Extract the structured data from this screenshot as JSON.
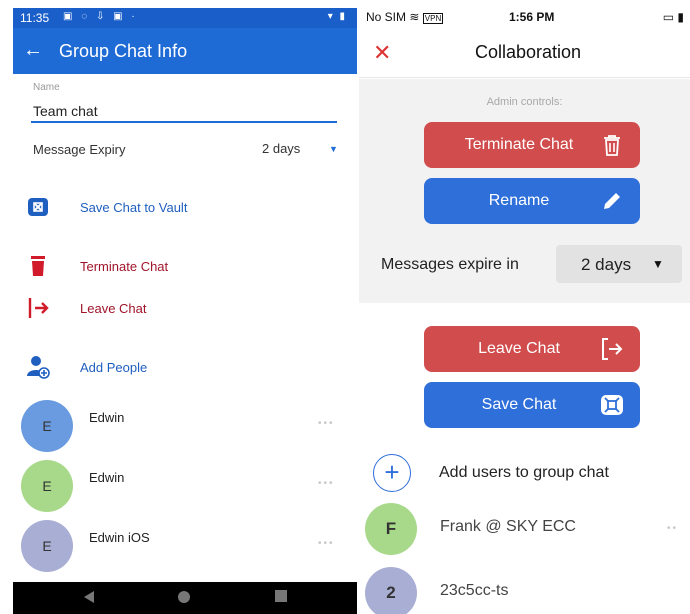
{
  "android": {
    "status": {
      "time": "11:35"
    },
    "appbar": {
      "title": "Group Chat Info"
    },
    "name_field": {
      "label": "Name",
      "value": "Team chat"
    },
    "expiry": {
      "label": "Message Expiry",
      "value": "2 days"
    },
    "actions": [
      {
        "label": "Save Chat to Vault",
        "icon": "vault-icon"
      },
      {
        "label": "Terminate Chat",
        "icon": "trash-icon"
      },
      {
        "label": "Leave Chat",
        "icon": "exit-icon"
      },
      {
        "label": "Add People",
        "icon": "add-person-icon"
      }
    ],
    "members": [
      {
        "initial": "E",
        "name": "Edwin",
        "color": "#6a9be0"
      },
      {
        "initial": "E",
        "name": "Edwin",
        "color": "#a8d98a"
      },
      {
        "initial": "E",
        "name": "Edwin iOS",
        "color": "#a9aed4"
      }
    ],
    "more_glyph": "•••",
    "colors": {
      "primary": "#1f6bd6",
      "danger": "#a0142a"
    }
  },
  "ios": {
    "status": {
      "carrier": "No SIM",
      "vpn": "VPN",
      "time": "1:56 PM"
    },
    "header": {
      "close": "✕",
      "title": "Collaboration"
    },
    "admin": {
      "label": "Admin controls:",
      "terminate": "Terminate Chat",
      "rename": "Rename",
      "expire_label": "Messages expire in",
      "expire_value": "2 days"
    },
    "leave": "Leave Chat",
    "save": "Save Chat",
    "add_users": "Add users to group chat",
    "users": [
      {
        "initial": "F",
        "name": "Frank @ SKY ECC",
        "color": "#a8d98a"
      },
      {
        "initial": "2",
        "name": "23c5cc-ts",
        "color": "#a9aed4"
      }
    ],
    "more_glyph": "••",
    "colors": {
      "danger": "#d14d4d",
      "primary": "#2f6fd9",
      "panel": "#f2f2f2"
    }
  }
}
